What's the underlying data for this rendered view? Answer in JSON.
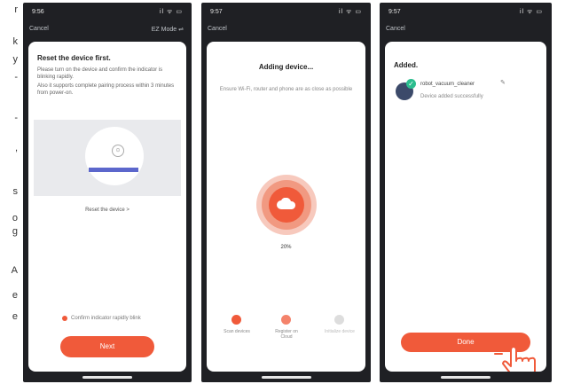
{
  "left_fragment": [
    "r",
    "k",
    "y",
    "-",
    "",
    "-",
    ",",
    "",
    "s",
    "o",
    "g",
    "A",
    "e",
    "e"
  ],
  "screen1": {
    "time": "9:56",
    "signal": "il ᯤ ▭",
    "cancel": "Cancel",
    "mode": "EZ Mode",
    "title": "Reset the device first.",
    "instr1": "Please turn on the device and confirm the indicator is blinking rapidly.",
    "instr2": "Also it supports complete pairing process within 3 minutes from power-on.",
    "reset_link": "Reset the device >",
    "confirm_text": "Confirm indicator rapidly blink",
    "next": "Next"
  },
  "screen2": {
    "time": "9:57",
    "signal": "il ᯤ ▭",
    "cancel": "Cancel",
    "title": "Adding device...",
    "subtitle": "Ensure Wi-Fi, router and phone are as close as possible",
    "progress_percent": 20,
    "percent": "20%",
    "steps": [
      {
        "label": "Scan devices",
        "state": "done"
      },
      {
        "label": "Register on Cloud",
        "state": "active"
      },
      {
        "label": "Initialize device",
        "state": "pending"
      }
    ]
  },
  "screen3": {
    "time": "9:57",
    "signal": "il ᯤ ▭",
    "cancel": "Cancel",
    "title": "Added.",
    "device_name": "robot_vacuum_cleaner",
    "device_status": "Device added successfully",
    "done": "Done"
  },
  "colors": {
    "accent": "#f05a3a",
    "success": "#2bbd8e",
    "phone_bg": "#1f2024"
  },
  "icons": [
    "check-icon",
    "cloud-icon",
    "edit-icon",
    "tap-hand-icon"
  ]
}
